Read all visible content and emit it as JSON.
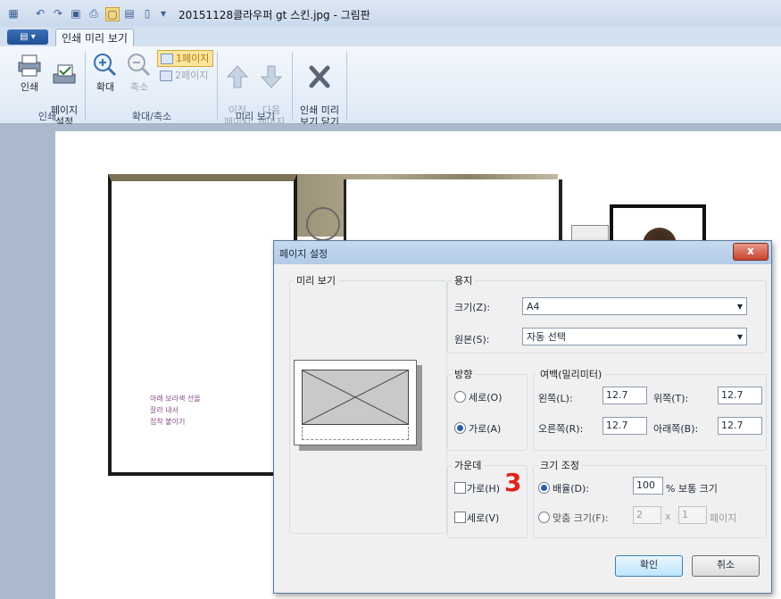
{
  "window": {
    "title": "20151128클라우퍼 gt 스킨.jpg - 그림판"
  },
  "quick_access": {
    "icons": [
      "paint-icon",
      "undo-icon",
      "redo-icon",
      "save-icon",
      "print-icon",
      "print-preview-icon",
      "page-setup-icon",
      "new-icon",
      "customize-dropdown-icon"
    ]
  },
  "ribbon": {
    "app_menu_label": "▤ ▾",
    "tab_label": "인쇄 미리 보기",
    "groups": {
      "print": {
        "label": "인쇄",
        "print_button": "인쇄",
        "page_setup_button": "페이지\n설정"
      },
      "zoom": {
        "label": "확대/축소",
        "zoom_in_button": "확대",
        "zoom_out_button": "축소",
        "one_page_button": "1페이지",
        "two_page_button": "2페이지"
      },
      "preview": {
        "label": "미리 보기",
        "prev_page_button": "이전\n페이지",
        "next_page_button": "다음\n페이지"
      },
      "close": {
        "close_preview_button": "인쇄 미리\n보기 닫기"
      }
    }
  },
  "preview_image": {
    "note_lines": [
      "아래 보라색 선을",
      "잘라 내서",
      "접착 붙이기"
    ]
  },
  "dialog": {
    "title": "페이지 설정",
    "close_label": "x",
    "preview_legend": "미리 보기",
    "paper": {
      "legend": "용지",
      "size_label": "크기(Z):",
      "size_value": "A4",
      "source_label": "원본(S):",
      "source_value": "자동 선택"
    },
    "orientation": {
      "legend": "방향",
      "portrait_label": "세로(O)",
      "landscape_label": "가로(A)",
      "selected": "landscape"
    },
    "margins": {
      "legend": "여백(밀리미터)",
      "left_label": "왼쪽(L):",
      "left_value": "12.7",
      "top_label": "위쪽(T):",
      "top_value": "12.7",
      "right_label": "오른쪽(R):",
      "right_value": "12.7",
      "bottom_label": "아래쪽(B):",
      "bottom_value": "12.7"
    },
    "centering": {
      "legend": "가운데",
      "horizontal_label": "가로(H)",
      "vertical_label": "세로(V)"
    },
    "scaling": {
      "legend": "크기 조정",
      "adjust_label": "배율(D):",
      "adjust_value": "100",
      "adjust_suffix": "% 보통 크기",
      "fit_label": "맞춤 크기(F):",
      "fit_w": "2",
      "fit_x": "x",
      "fit_h": "1",
      "fit_suffix": "페이지",
      "selected": "adjust"
    },
    "ok_button": "확인",
    "cancel_button": "취소"
  },
  "annotation": {
    "number": "3",
    "color": "#e0221b"
  }
}
